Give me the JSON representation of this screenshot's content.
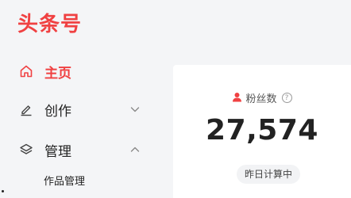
{
  "brand": {
    "logo_text": "头条号",
    "color": "#f04142"
  },
  "sidebar": {
    "items": [
      {
        "label": "主页",
        "icon": "home-icon",
        "active": true
      },
      {
        "label": "创作",
        "icon": "pen-icon",
        "expanded": false
      },
      {
        "label": "管理",
        "icon": "layers-icon",
        "expanded": true
      }
    ],
    "sub_items": [
      {
        "label": "作品管理"
      }
    ]
  },
  "stats": {
    "fans_label": "粉丝数",
    "fans_count": "27,574",
    "status": "昨日计算中"
  }
}
